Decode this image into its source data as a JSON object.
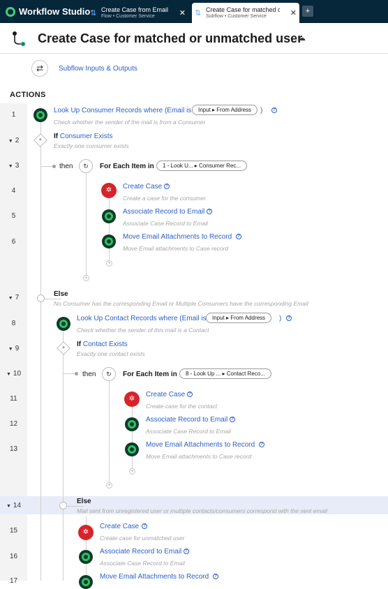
{
  "app": {
    "name": "Workflow Studio"
  },
  "tabs": [
    {
      "title": "Create Case from Email",
      "subtitle": "Flow • Customer Service",
      "close": "✕"
    },
    {
      "title": "Create Case for matched or",
      "subtitle": "Subflow • Customer Service",
      "close": "✕"
    }
  ],
  "add_tab": "+",
  "header": {
    "title": "Create Case for matched or unmatched user"
  },
  "io": {
    "label": "Subflow Inputs & Outputs"
  },
  "actions_heading": "ACTIONS",
  "rows": [
    "1",
    "2",
    "3",
    "4",
    "5",
    "6",
    "7",
    "8",
    "9",
    "10",
    "11",
    "12",
    "13",
    "14",
    "15",
    "16",
    "17"
  ],
  "steps": {
    "s1": {
      "title": "Look Up Consumer Records where (Email is",
      "pill_left": "Input",
      "pill_right": "From Address",
      "close_paren": ")",
      "sub": "Check whether the sender of the mail is from a Consumer"
    },
    "s2": {
      "if": "If",
      "cond": "Consumer Exists",
      "sub": "Exactly one consumer exists"
    },
    "s3": {
      "then": "then",
      "label": "For Each Item in",
      "pill_left": "1 - Look U...",
      "pill_right": "Consumer Rec..."
    },
    "s4": {
      "title": "Create Case",
      "sub": "Create a case for the consumer"
    },
    "s5": {
      "title": "Associate Record to Email",
      "sub": "Associate Case Record to Email"
    },
    "s6": {
      "title": "Move Email Attachments to Record",
      "sub": "Move Email attachments to Case record"
    },
    "s7": {
      "title": "Else",
      "sub": "No Consumer has the corresponding Email or Multiple Consumers have the corresponding Email"
    },
    "s8": {
      "title": "Look Up Contact Records where (Email is",
      "pill_left": "Input",
      "pill_right": "From Address",
      "close_paren": ")",
      "sub": "Check whether the sender of this mail is a Contact"
    },
    "s9": {
      "if": "If",
      "cond": "Contact Exists",
      "sub": "Exactly one contact exists"
    },
    "s10": {
      "then": "then",
      "label": "For Each Item in",
      "pill_left": "8 - Look Up ...",
      "pill_right": "Contact Reco..."
    },
    "s11": {
      "title": "Create Case",
      "sub": "Create case for the contact"
    },
    "s12": {
      "title": "Associate Record to Email",
      "sub": "Associate Case Record to Email"
    },
    "s13": {
      "title": "Move Email Attachments to Record",
      "sub": "Move Email attachments to Case record"
    },
    "s14": {
      "title": "Else",
      "sub": "Mail sent from unregistered user or multiple contacts/consumers correspond with the sent email"
    },
    "s15": {
      "title": "Create Case",
      "sub": "Create case for unmatched user"
    },
    "s16": {
      "title": "Associate Record to Email",
      "sub": "Associate Case Record to Email"
    },
    "s17": {
      "title": "Move Email Attachments to Record"
    }
  },
  "colors": {
    "topbar": "#06263a",
    "link": "#2a5ec9",
    "brand_green": "#2fc164",
    "create_case_red": "#d8232a",
    "highlight": "#e7ecf8"
  }
}
